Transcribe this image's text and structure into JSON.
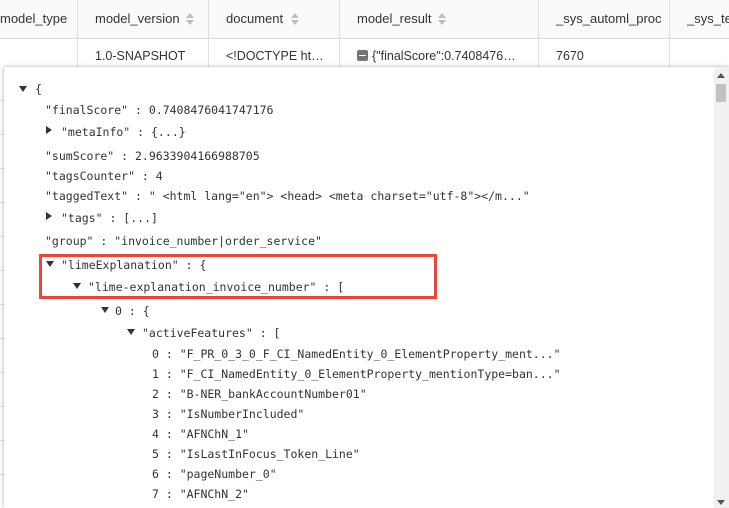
{
  "table": {
    "columns": [
      "model_type",
      "model_version",
      "document",
      "model_result",
      "_sys_automl_proc",
      "_sys_te"
    ],
    "row": {
      "model_version": "1.0-SNAPSHOT",
      "document": "<!DOCTYPE ht…",
      "model_result": "{\"finalScore\":0.7408476…",
      "sys_automl_proc": "7670"
    }
  },
  "json_view": {
    "root_open": "{",
    "finalScore": "\"finalScore\" : 0.7408476041747176",
    "metaInfo": "\"metaInfo\" : {...}",
    "sumScore": "\"sumScore\" : 2.9633904166988705",
    "tagsCounter": "\"tagsCounter\" : 4",
    "taggedText": "\"taggedText\" : \" <html lang=\"en\"> <head> <meta charset=\"utf-8\"></m...\"",
    "tags": "\"tags\" : [...]",
    "group": "\"group\" : \"invoice_number|order_service\"",
    "limeExplanation": "\"limeExplanation\" : {",
    "lime_invoice": "\"lime-explanation_invoice_number\" : [",
    "item0": "0 : {",
    "activeFeatures": "\"activeFeatures\" : [",
    "features": [
      "0 : \"F_PR_0_3_0_F_CI_NamedEntity_0_ElementProperty_ment...\"",
      "1 : \"F_CI_NamedEntity_0_ElementProperty_mentionType=ban...\"",
      "2 : \"B-NER_bankAccountNumber01\"",
      "3 : \"IsNumberIncluded\"",
      "4 : \"AFNChN_1\"",
      "5 : \"IsLastInFocus_Token_Line\"",
      "6 : \"pageNumber_0\"",
      "7 : \"AFNChN_2\""
    ]
  },
  "colors": {
    "highlight": "#e8473a",
    "header_bg": "#fafafa"
  },
  "icons": [
    "sort-icon",
    "collapse-icon",
    "caret-down-icon",
    "caret-right-icon"
  ]
}
